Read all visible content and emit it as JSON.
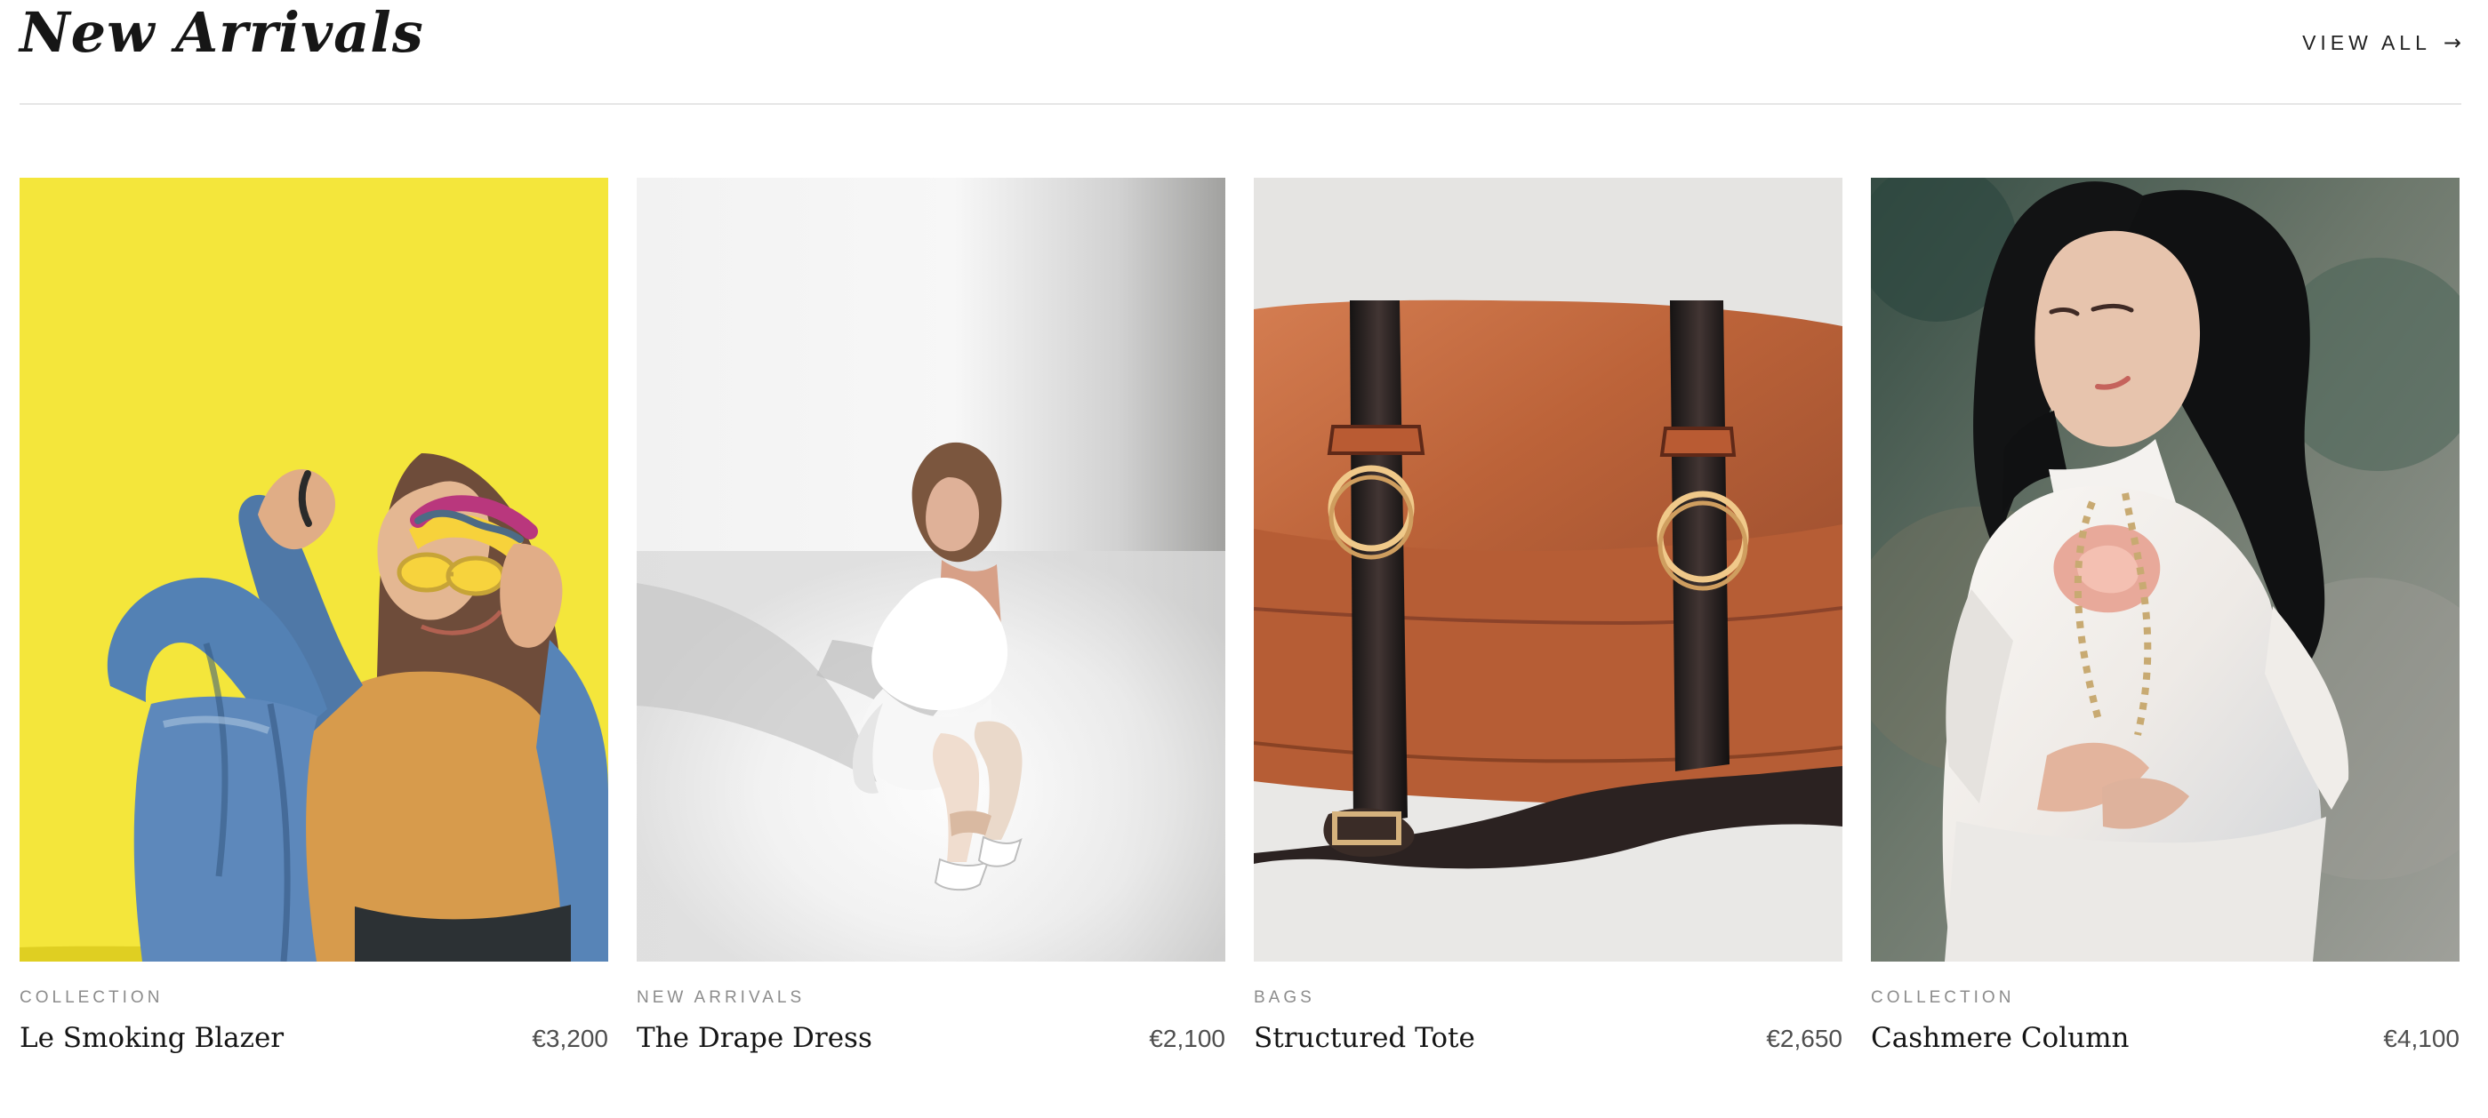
{
  "section": {
    "title": "New Arrivals",
    "view_all_label": "VIEW ALL",
    "view_all_arrow": "→"
  },
  "products": [
    {
      "category": "COLLECTION",
      "name": "Le Smoking Blazer",
      "price": "€3,200",
      "image": "photo of a woman in denim jacket and sunglasses against a yellow wall"
    },
    {
      "category": "NEW ARRIVALS",
      "name": "The Drape Dress",
      "price": "€2,100",
      "image": "photo of a woman crouching in a white dress against a white studio backdrop"
    },
    {
      "category": "BAGS",
      "name": "Structured Tote",
      "price": "€2,650",
      "image": "photo of a brown leather messenger bag with dark straps and brass rings"
    },
    {
      "category": "COLLECTION",
      "name": "Cashmere Column",
      "price": "€4,100",
      "image": "photo of a woman with long dark hair in a white embroidered dress outdoors"
    }
  ],
  "colors": {
    "background": "#ffffff",
    "title": "#161616",
    "category": "#8c8c8c",
    "price": "#4e4e4e",
    "divider": "#e6e6e6",
    "card1_backdrop": "#f2e332",
    "card2_backdrop": "#e8e8e8",
    "card3_backdrop": "#e4e4e2",
    "card4_backdrop": "#59685d"
  }
}
